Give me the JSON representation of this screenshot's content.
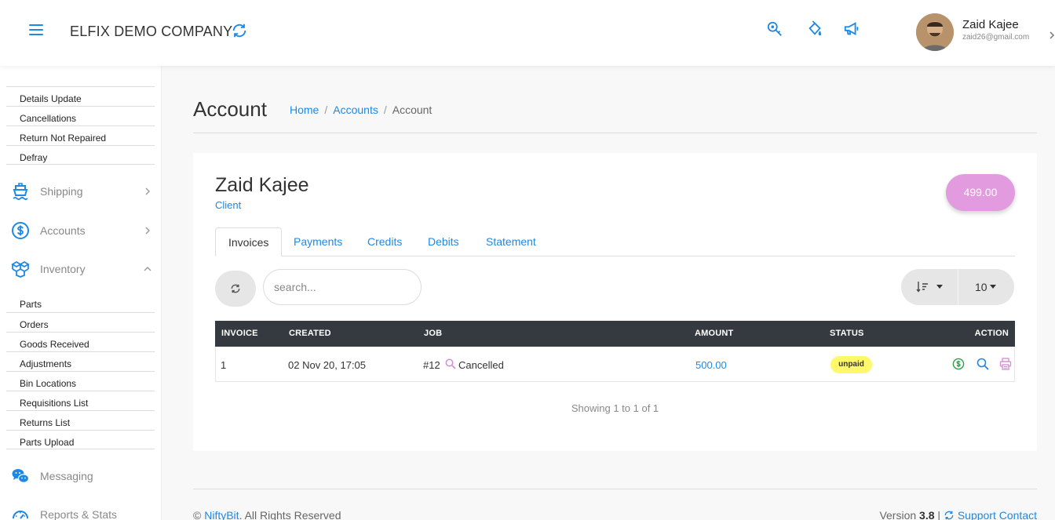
{
  "header": {
    "company": "ELFIX DEMO COMPANY",
    "user_name": "Zaid Kajee",
    "user_email": "zaid26@gmail.com",
    "icons": [
      "search-key-icon",
      "paint-bucket-icon",
      "megaphone-icon"
    ]
  },
  "sidebar": {
    "top_subitems": [
      "Details Update",
      "Cancellations",
      "Return Not Repaired",
      "Defray"
    ],
    "nav": {
      "shipping": "Shipping",
      "accounts": "Accounts",
      "inventory": "Inventory",
      "messaging": "Messaging",
      "reports": "Reports & Stats"
    },
    "inventory_subitems": [
      "Parts",
      "Orders",
      "Goods Received",
      "Adjustments",
      "Bin Locations",
      "Requisitions List",
      "Returns List",
      "Parts Upload"
    ]
  },
  "page": {
    "title": "Account",
    "breadcrumb": [
      "Home",
      "Accounts",
      "Account"
    ]
  },
  "client": {
    "name": "Zaid Kajee",
    "role": "Client",
    "balance": "499.00"
  },
  "tabs": [
    "Invoices",
    "Payments",
    "Credits",
    "Debits",
    "Statement"
  ],
  "toolbar": {
    "search_placeholder": "search...",
    "page_size": "10"
  },
  "table": {
    "headers": [
      "INVOICE",
      "CREATED",
      "JOB",
      "AMOUNT",
      "STATUS",
      "ACTION"
    ],
    "rows": [
      {
        "invoice": "1",
        "created": "02 Nov 20, 17:05",
        "job_no": "#12",
        "job_status": "Cancelled",
        "amount": "500.00",
        "status": "unpaid"
      }
    ]
  },
  "pagination_text": "Showing 1 to 1 of 1",
  "footer": {
    "copy_symbol": "©",
    "brand": "NiftyBit",
    "rights": ". All Rights Reserved",
    "version_label": "Version",
    "version": "3.8",
    "support": "Support Contact"
  },
  "colors": {
    "accent": "#1e88e5",
    "balance_pill": "#e39be0",
    "unpaid_badge": "#fff86a",
    "table_header": "#343a40"
  }
}
